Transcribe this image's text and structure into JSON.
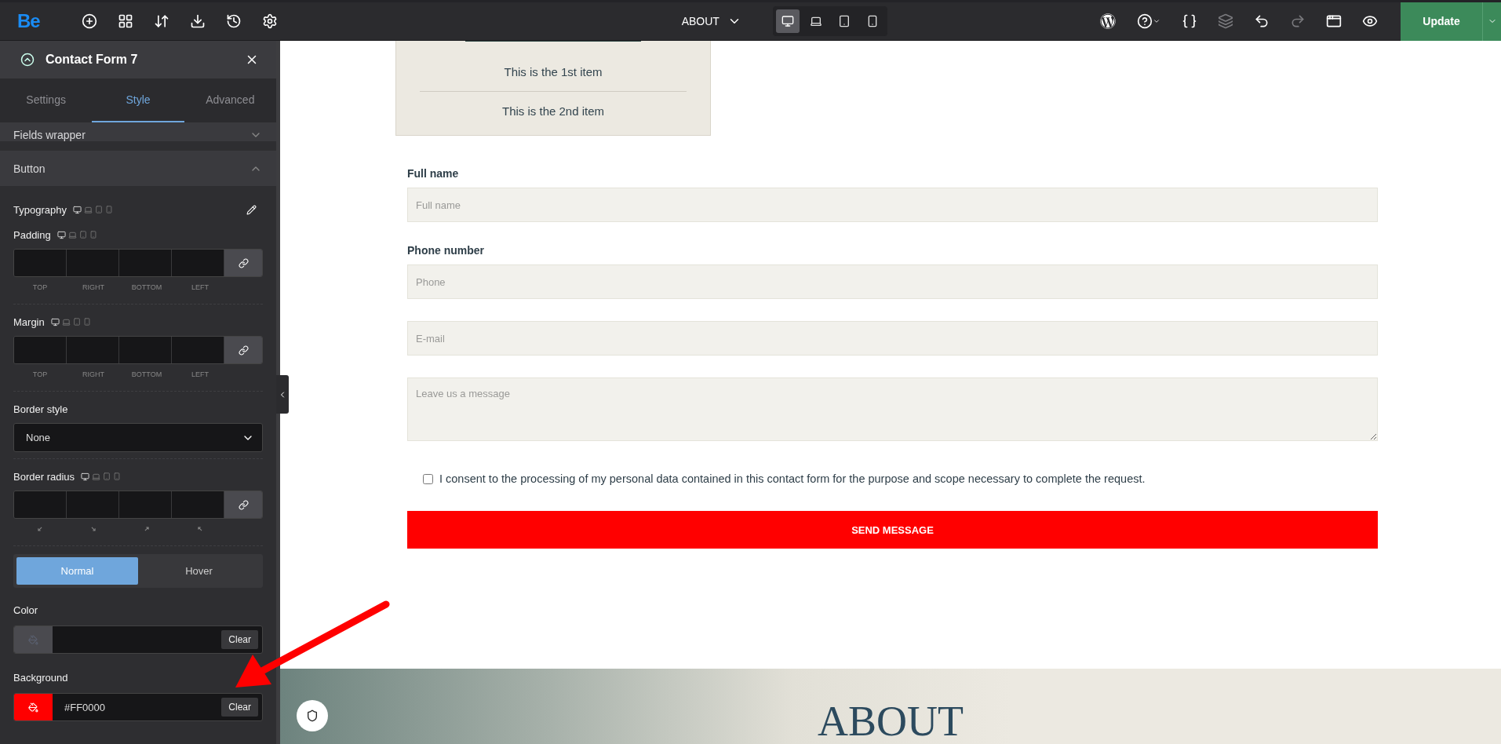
{
  "topbar": {
    "logo": "Be",
    "page": "ABOUT",
    "devices": [
      {
        "kind": "desktop",
        "selected": true
      },
      {
        "kind": "laptop",
        "selected": false
      },
      {
        "kind": "tablet",
        "selected": false
      },
      {
        "kind": "mobile",
        "selected": false
      }
    ],
    "update_button": "Update"
  },
  "panel": {
    "title": "Contact Form 7",
    "tabs": [
      {
        "label": "Settings",
        "selected": false
      },
      {
        "label": "Style",
        "selected": true
      },
      {
        "label": "Advanced",
        "selected": false
      }
    ],
    "sections": [
      {
        "title": "Fields wrapper",
        "expanded": false
      },
      {
        "title": "Button",
        "expanded": true
      }
    ],
    "typography_label": "Typography",
    "spacing": [
      {
        "label": "Padding",
        "sides": [
          "TOP",
          "RIGHT",
          "BOTTOM",
          "LEFT"
        ]
      },
      {
        "label": "Margin",
        "sides": [
          "TOP",
          "RIGHT",
          "BOTTOM",
          "LEFT"
        ]
      }
    ],
    "border_style": {
      "label": "Border style",
      "value": "None"
    },
    "border_radius_label": "Border radius",
    "states": [
      {
        "label": "Normal",
        "selected": true
      },
      {
        "label": "Hover",
        "selected": false
      }
    ],
    "colors": [
      {
        "label": "Color",
        "clear": "Clear"
      },
      {
        "label": "Background",
        "color": "#ff0000",
        "value": "#FF0000",
        "clear": "Clear"
      }
    ]
  },
  "canvas": {
    "list_items": [
      "This is the 1st item",
      "This is the 2nd item"
    ],
    "fields": [
      {
        "kind": "input",
        "label": "Full name",
        "placeholder": "Full name"
      },
      {
        "kind": "input",
        "label": "Phone number",
        "placeholder": "Phone"
      },
      {
        "kind": "input",
        "placeholder": "E-mail"
      },
      {
        "kind": "textarea",
        "placeholder": "Leave us a message"
      }
    ],
    "consent": {
      "text": "I consent to the processing of my personal data contained in this contact form for the purpose and scope necessary to complete the request.",
      "checked": false
    },
    "submit": "SEND MESSAGE",
    "hero_title": "ABOUT"
  }
}
